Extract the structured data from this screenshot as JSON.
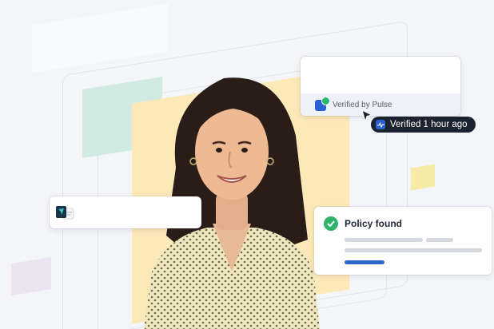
{
  "verification": {
    "source_label": "Verified by Pulse",
    "status_pill": "Verified 1 hour ago"
  },
  "policy_card": {
    "title": "Policy found"
  },
  "colors": {
    "accent_blue": "#2c5fd6",
    "success_green": "#2fb26a",
    "pill_dark": "#1b2230",
    "photo_backdrop": "#fde9b8",
    "decor_mint": "#cde9df"
  },
  "icons": [
    "pulse-badge-icon",
    "verified-check-icon",
    "cursor-arrow-icon",
    "app-logo-icon",
    "policy-check-icon"
  ]
}
